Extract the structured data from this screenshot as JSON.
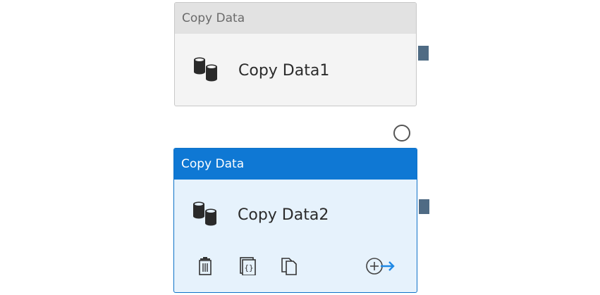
{
  "activities": [
    {
      "header": "Copy Data",
      "name": "Copy Data1",
      "icon": "database-copy-icon",
      "selected": false
    },
    {
      "header": "Copy Data",
      "name": "Copy Data2",
      "icon": "database-copy-icon",
      "selected": true,
      "actions": [
        "delete-icon",
        "code-icon",
        "clone-icon",
        "add-output-icon"
      ]
    }
  ],
  "colors": {
    "selected_header": "#0f78d4",
    "selected_body": "#e6f2fc",
    "default_header": "#e2e2e2",
    "default_body": "#f4f4f4",
    "output_handle": "#4f6b84",
    "arrow_accent": "#1e88e5"
  }
}
